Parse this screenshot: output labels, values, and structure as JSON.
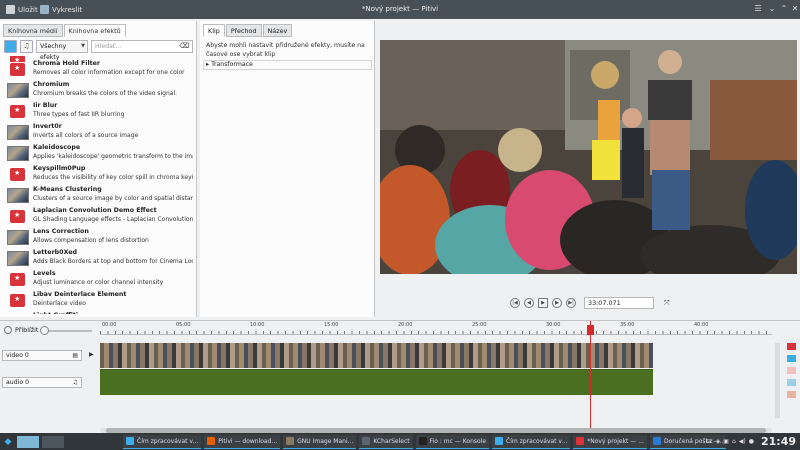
{
  "titlebar": {
    "save_label": "Uložit",
    "render_label": "Vykreslit",
    "title": "*Nový projekt — Pitivi"
  },
  "left": {
    "tabs": [
      "Knihovna médií",
      "Knihovna efektů"
    ],
    "category": "Všechny efekty",
    "search_placeholder": "Hledat...",
    "effects": [
      {
        "name": "",
        "desc": "",
        "thumb": "red"
      },
      {
        "name": "Chroma Hold Filter",
        "desc": "Removes all color information except for one color",
        "thumb": "red"
      },
      {
        "name": "Chromium",
        "desc": "Chromium breaks the colors of the video signal.",
        "thumb": "photo"
      },
      {
        "name": "Iir Blur",
        "desc": "Three types of fast IIR blurring",
        "thumb": "red"
      },
      {
        "name": "Invert0r",
        "desc": "Inverts all colors of a source image",
        "thumb": "photo"
      },
      {
        "name": "Kaleidoscope",
        "desc": "Applies 'kaleidoscope' geometric transform to the image",
        "thumb": "photo"
      },
      {
        "name": "Keyspillm0Pup",
        "desc": "Reduces the visibility of key color spill in chroma keying",
        "thumb": "red"
      },
      {
        "name": "K-Means Clustering",
        "desc": "Clusters of a source image by color and spatial distance",
        "thumb": "photo"
      },
      {
        "name": "Laplacian Convolution Demo Effect",
        "desc": "GL Shading Language effects - Laplacian Convolution Demo E...",
        "thumb": "red"
      },
      {
        "name": "Lens Correction",
        "desc": "Allows compensation of lens distortion",
        "thumb": "photo"
      },
      {
        "name": "Letterb0Xed",
        "desc": "Adds Black Borders at top and bottom for Cinema Look",
        "thumb": "photo"
      },
      {
        "name": "Levels",
        "desc": "Adjust luminance or color channel intensity",
        "thumb": "red"
      },
      {
        "name": "Libav Deinterlace Element",
        "desc": "Deinterlace video",
        "thumb": "red"
      },
      {
        "name": "Light Graffiti",
        "desc": "",
        "thumb": "red"
      }
    ]
  },
  "middle": {
    "tabs": [
      "Klip",
      "Přechod",
      "Název"
    ],
    "message": "Abyste mohli nastavit přidružené efekty, musíte na časové ose vybrat klip",
    "expander": "Transformace"
  },
  "viewer": {
    "timecode": "33:07.071"
  },
  "timeline": {
    "zoom_label": "Přiblížit",
    "ticks": [
      "00:00",
      "05:00",
      "10:00",
      "15:00",
      "20:00",
      "25:00",
      "30:00",
      "35:00",
      "40:00"
    ],
    "video_track": "video 0",
    "audio_track": "audio 0"
  },
  "taskbar": {
    "tasks": [
      {
        "label": "Čím zpracovávat v...",
        "color": "#3daee9"
      },
      {
        "label": "Pitivi — download...",
        "color": "#e66000"
      },
      {
        "label": "GNU Image Mani...",
        "color": "#8a7a60"
      },
      {
        "label": "KCharSelect",
        "color": "#5b6470"
      },
      {
        "label": "Fio : mc — Konsole",
        "color": "#222"
      },
      {
        "label": "Čím zpracovávat v...",
        "color": "#3daee9"
      },
      {
        "label": "*Nový projekt — ...",
        "color": "#d8333a"
      },
      {
        "label": "Doručená pošta - ...",
        "color": "#2c7bd3"
      }
    ],
    "lang": "cz",
    "clock": "21:49"
  }
}
